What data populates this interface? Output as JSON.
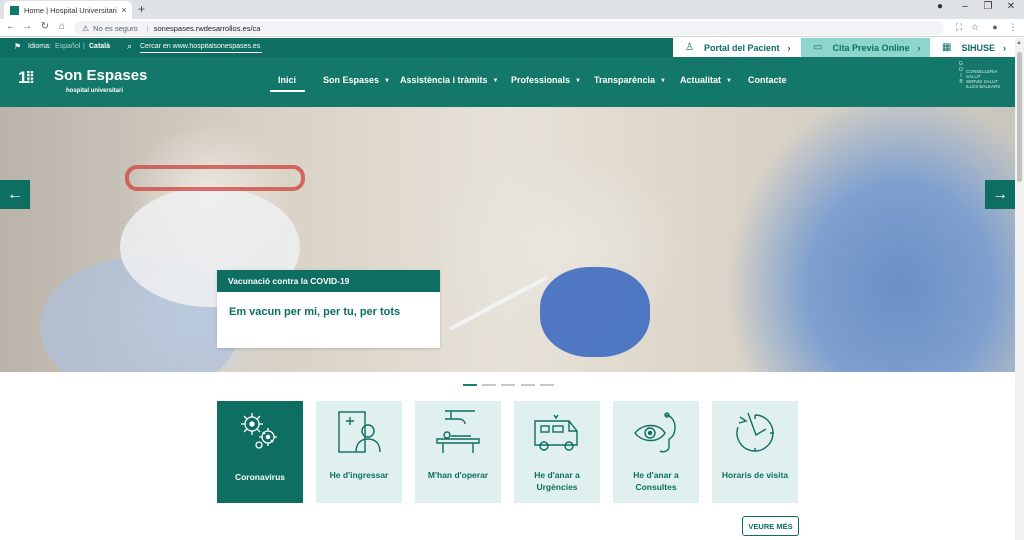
{
  "browser": {
    "tab_title": "Home | Hospital Universitari Son Espases",
    "new_tab": "+",
    "close_tab": "×",
    "security": "No es seguro",
    "url": "sonespases.rwdesarrollos.es/ca"
  },
  "topbar": {
    "language_label": "Idioma:",
    "lang_es": "Español",
    "lang_ca": "Català",
    "search_placeholder": "Cercar en www.hospitalsonespases.es",
    "links": [
      {
        "label": "Portal del Pacient",
        "bg": "#ffffff",
        "fg": "#0e6e62"
      },
      {
        "label": "Cita Previa Online",
        "bg": "#8ed6cb",
        "fg": "#0e6e62"
      },
      {
        "label": "SIHUSE",
        "bg": "#ffffff",
        "fg": "#0e6e62"
      }
    ]
  },
  "header": {
    "logo_name": "Son Espases",
    "logo_sub": "hospital universitari",
    "nav": [
      {
        "label": "Inici",
        "dropdown": false
      },
      {
        "label": "Son Espases",
        "dropdown": true
      },
      {
        "label": "Assistència i tràmits",
        "dropdown": true
      },
      {
        "label": "Professionals",
        "dropdown": true
      },
      {
        "label": "Transparència",
        "dropdown": true
      },
      {
        "label": "Actualitat",
        "dropdown": true
      },
      {
        "label": "Contacte",
        "dropdown": false
      }
    ],
    "goib_text": [
      "CONSELLERIA",
      "SALUT",
      "SERVEI SALUT",
      "ILLES BALEARS"
    ],
    "goib_vertical": [
      "G",
      "O",
      "I",
      "B"
    ]
  },
  "hero": {
    "caption_title": "Vacunació contra la COVID-19",
    "caption_text": "Em vacun per mi, per tu, per tots",
    "slides": 5,
    "active_slide": 0
  },
  "tiles": [
    {
      "label": "Coronavirus",
      "icon": "virus-icon",
      "active": true
    },
    {
      "label": "He d'ingressar",
      "icon": "hospital-bed-icon",
      "active": false
    },
    {
      "label": "M'han d'operar",
      "icon": "surgery-icon",
      "active": false
    },
    {
      "label": "He d'anar a Urgències",
      "icon": "ambulance-icon",
      "active": false
    },
    {
      "label": "He d'anar a Consultes",
      "icon": "stethoscope-eye-icon",
      "active": false
    },
    {
      "label": "Horaris de visita",
      "icon": "clock-icon",
      "active": false
    }
  ],
  "more_button": "VEURE MÉS",
  "colors": {
    "primary": "#0e6e62",
    "header": "#13776a",
    "tile_bg": "#dff0ee",
    "accent": "#8ed6cb"
  }
}
